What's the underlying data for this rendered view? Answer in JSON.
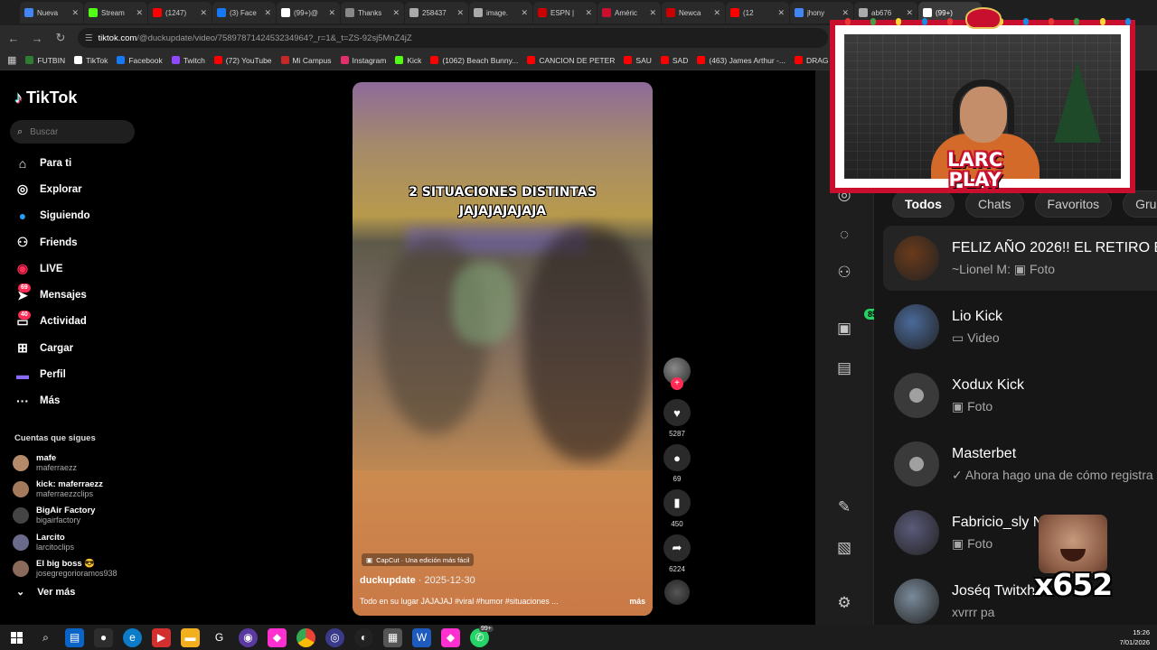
{
  "browser": {
    "tabs": [
      {
        "title": "Nueva",
        "color": "#4285f4"
      },
      {
        "title": "Stream",
        "color": "#53fc18"
      },
      {
        "title": "(1247)",
        "color": "#ff0000"
      },
      {
        "title": "(3) Face",
        "color": "#1877f2"
      },
      {
        "title": "(99+)@",
        "color": "#ffffff"
      },
      {
        "title": "Thanks",
        "color": "#888888"
      },
      {
        "title": "258437",
        "color": "#aaaaaa"
      },
      {
        "title": "image.",
        "color": "#aaaaaa"
      },
      {
        "title": "ESPN |",
        "color": "#cc0000"
      },
      {
        "title": "Améric",
        "color": "#c8102e"
      },
      {
        "title": "Newca",
        "color": "#cc0000"
      },
      {
        "title": "(12",
        "color": "#ff0000"
      },
      {
        "title": "jhony",
        "color": "#4285f4"
      },
      {
        "title": "ab676",
        "color": "#aaaaaa"
      },
      {
        "title": "(99+)",
        "color": "#ffffff"
      }
    ],
    "url_host": "tiktok.com",
    "url_path": "/@duckupdate/video/7589787142453234964?_r=1&_t=ZS-92sj5MnZ4jZ",
    "bookmarks": [
      {
        "label": "FUTBIN",
        "color": "#2e7d32"
      },
      {
        "label": "TikTok",
        "color": "#ffffff"
      },
      {
        "label": "Facebook",
        "color": "#1877f2"
      },
      {
        "label": "Twitch",
        "color": "#9146ff"
      },
      {
        "label": "(72) YouTube",
        "color": "#ff0000"
      },
      {
        "label": "Mi Campus",
        "color": "#c62828"
      },
      {
        "label": "Instagram",
        "color": "#e1306c"
      },
      {
        "label": "Kick",
        "color": "#53fc18"
      },
      {
        "label": "(1062) Beach Bunny...",
        "color": "#ff0000"
      },
      {
        "label": "CANCION DE PETER",
        "color": "#ff0000"
      },
      {
        "label": "SAU",
        "color": "#ff0000"
      },
      {
        "label": "SAD",
        "color": "#ff0000"
      },
      {
        "label": "(463) James Arthur -...",
        "color": "#ff0000"
      },
      {
        "label": "DRAG",
        "color": "#ff0000"
      }
    ]
  },
  "tiktok": {
    "logo": "TikTok",
    "search_placeholder": "Buscar",
    "nav": [
      {
        "label": "Para ti",
        "icon": "home-icon",
        "glyph": "⌂"
      },
      {
        "label": "Explorar",
        "icon": "compass-icon",
        "glyph": "◎"
      },
      {
        "label": "Siguiendo",
        "icon": "following-avatar-icon",
        "glyph": "●"
      },
      {
        "label": "Friends",
        "icon": "friends-icon",
        "glyph": "⚇"
      },
      {
        "label": "LIVE",
        "icon": "live-icon",
        "glyph": "◉"
      },
      {
        "label": "Mensajes",
        "icon": "messages-icon",
        "glyph": "➤",
        "badge": "69"
      },
      {
        "label": "Actividad",
        "icon": "activity-icon",
        "glyph": "▭",
        "badge": "40"
      },
      {
        "label": "Cargar",
        "icon": "upload-icon",
        "glyph": "⊞"
      },
      {
        "label": "Perfil",
        "icon": "profile-icon",
        "glyph": "▬"
      },
      {
        "label": "Más",
        "icon": "more-icon",
        "glyph": "···"
      }
    ],
    "following_title": "Cuentas que sigues",
    "following": [
      {
        "name": "mafe",
        "handle": "maferraezz",
        "color": "#b58a6a"
      },
      {
        "name": "kick: maferraezz",
        "handle": "maferraezzclips",
        "color": "#a37b5c"
      },
      {
        "name": "BigAir Factory",
        "handle": "bigairfactory",
        "color": "#444444"
      },
      {
        "name": "Larcito",
        "handle": "larcitoclips",
        "color": "#6a6a8a"
      },
      {
        "name": "El big boss 😎",
        "handle": "josegregorioramos938",
        "color": "#8a6a5a"
      }
    ],
    "see_more": "Ver más",
    "video": {
      "caption_line1": "2 SITUACIONES DISTINTAS",
      "caption_line2": "JAJAJAJAJAJA",
      "capcut": "CapCut · Una edición más fácil",
      "author": "duckupdate",
      "date": " · 2025-12-30",
      "description": "Todo en su lugar JAJAJAJ #viral #humor #situaciones ...",
      "more": "más"
    },
    "actions": [
      {
        "icon": "heart-icon",
        "glyph": "♥",
        "count": "5287"
      },
      {
        "icon": "comment-icon",
        "glyph": "●",
        "count": "69"
      },
      {
        "icon": "bookmark-icon",
        "glyph": "▮",
        "count": "450"
      },
      {
        "icon": "share-icon",
        "glyph": "➦",
        "count": "6224"
      }
    ]
  },
  "whatsapp": {
    "chips": [
      "Todos",
      "Chats",
      "Favoritos",
      "Gru"
    ],
    "rail_badge": "85",
    "chats": [
      {
        "name": "FELIZ AÑO 2026!! EL RETIRO ES",
        "message": "~Lionel M:  ▣ Foto",
        "avatar_color": "#6a3a1a",
        "ghost": false
      },
      {
        "name": "Lio Kick",
        "message": "▭ Video",
        "avatar_color": "#4a6a9a",
        "ghost": false
      },
      {
        "name": "Xodux Kick",
        "message": "▣ Foto",
        "avatar_color": "#3a3a3a",
        "ghost": true
      },
      {
        "name": "Masterbet",
        "message": "✓ Ahora hago una de cómo registra",
        "avatar_color": "#3a3a3a",
        "ghost": true
      },
      {
        "name": "Fabricio_sly N",
        "message": "▣ Foto",
        "avatar_color": "#5a5a7a",
        "ghost": false
      },
      {
        "name": "Joséq Twitxh",
        "message": "xvrrr pa",
        "avatar_color": "#7a8a9a",
        "ghost": false
      }
    ]
  },
  "overlay": {
    "logo_line1": "LARC",
    "logo_line2": "PLAY",
    "emote_count": "x652"
  },
  "taskbar": {
    "time": "15:26",
    "date": "7/01/2026",
    "badge": "99+"
  }
}
